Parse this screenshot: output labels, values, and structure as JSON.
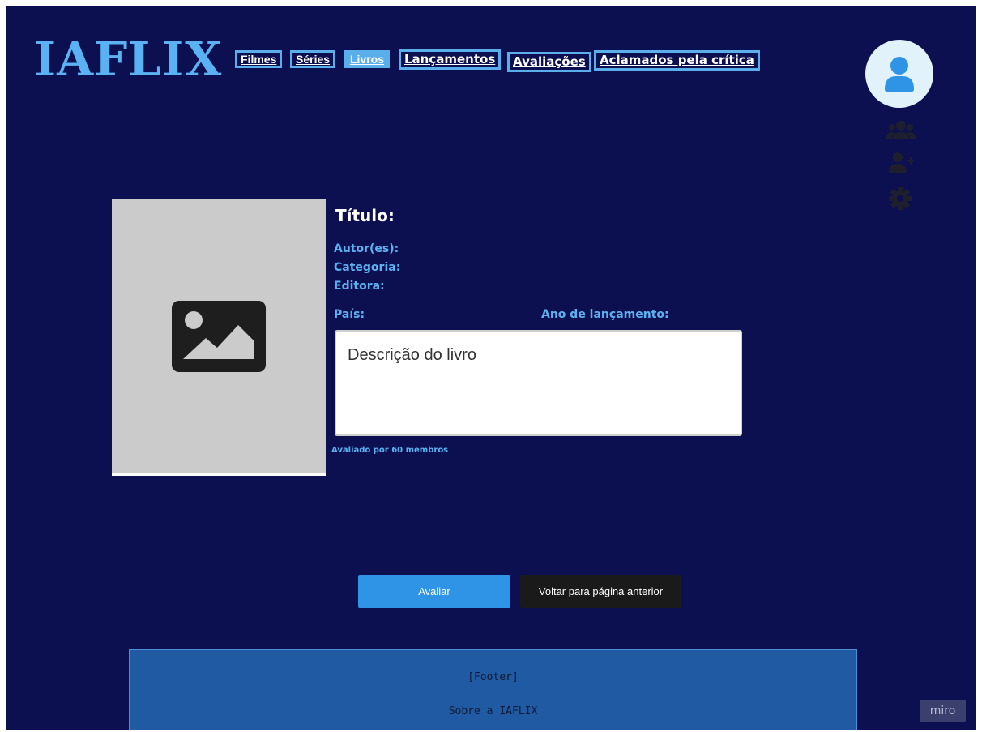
{
  "brand": {
    "logo": "IAFLIX"
  },
  "nav": {
    "items": [
      {
        "label": "Filmes"
      },
      {
        "label": "Séries"
      },
      {
        "label": "Livros"
      },
      {
        "label": "Lançamentos"
      },
      {
        "label": "Avaliações"
      },
      {
        "label": "Aclamados pela crítica"
      }
    ],
    "active": "Livros"
  },
  "sidebar": {
    "icons": [
      "user-icon",
      "users-group-icon",
      "add-user-icon",
      "gear-icon"
    ]
  },
  "book": {
    "title_label": "Título:",
    "author_label": "Autor(es):",
    "category_label": "Categoria:",
    "publisher_label": "Editora:",
    "country_label": "País:",
    "release_label": "Ano de lançamento:",
    "description": "Descrição do livro",
    "rated_by": "Avaliado por 60 membros"
  },
  "actions": {
    "rate_label": "Avaliar",
    "back_label": "Voltar para página anterior"
  },
  "footer": {
    "placeholder": "[Footer]",
    "about": "Sobre a IAFLIX"
  },
  "watermark": "miro",
  "colors": {
    "background": "#0c1050",
    "accent": "#5bb2f2",
    "button_primary": "#2f93e6",
    "button_dark": "#1a1a1a",
    "footer": "#1f5aa3"
  }
}
